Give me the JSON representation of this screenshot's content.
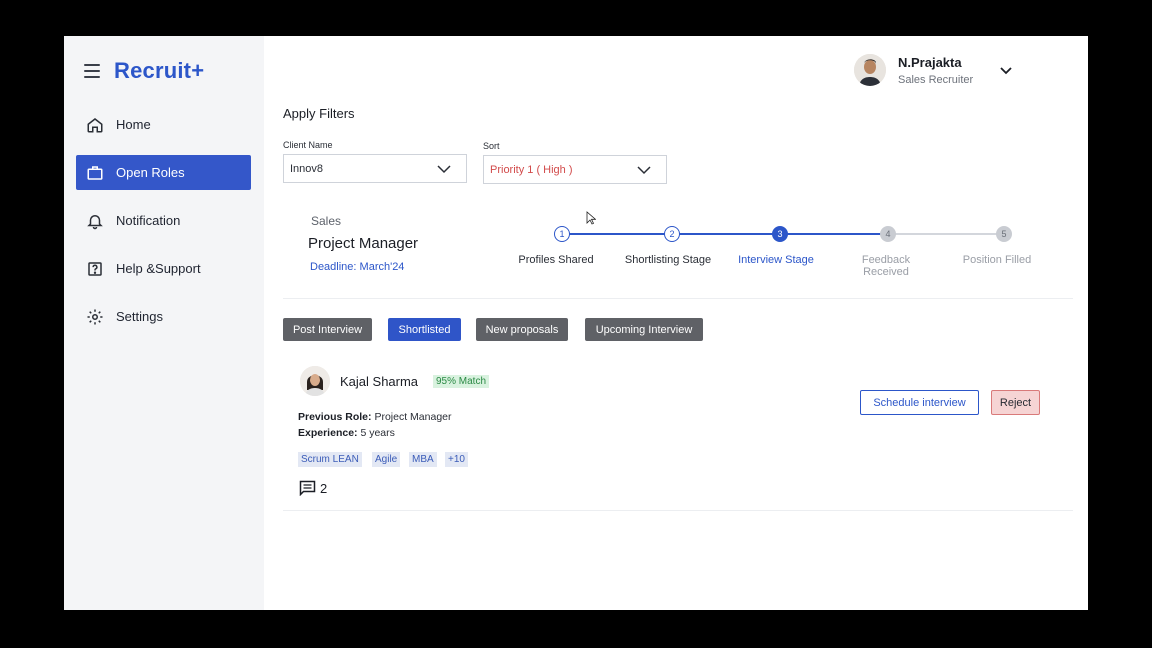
{
  "app": {
    "brand": "Recruit+"
  },
  "sidebar": {
    "items": [
      {
        "label": "Home",
        "icon": "home-icon"
      },
      {
        "label": "Open Roles",
        "icon": "briefcase-icon",
        "active": true
      },
      {
        "label": "Notification",
        "icon": "bell-icon"
      },
      {
        "label": "Help &Support",
        "icon": "help-icon"
      },
      {
        "label": "Settings",
        "icon": "gear-icon"
      }
    ]
  },
  "user": {
    "name": "N.Prajakta",
    "role": "Sales Recruiter"
  },
  "filters": {
    "title": "Apply Filters",
    "client": {
      "label": "Client Name",
      "value": "Innov8"
    },
    "sort": {
      "label": "Sort",
      "value": "Priority 1 ( High )"
    }
  },
  "role": {
    "department": "Sales",
    "title": "Project Manager",
    "deadline": "Deadline: March'24"
  },
  "stepper": {
    "current": 3,
    "steps": [
      {
        "num": "1",
        "label": "Profiles Shared",
        "state": "done"
      },
      {
        "num": "2",
        "label": "Shortlisting Stage",
        "state": "done"
      },
      {
        "num": "3",
        "label": "Interview Stage",
        "state": "current"
      },
      {
        "num": "4",
        "label": "Feedback Received",
        "state": "todo"
      },
      {
        "num": "5",
        "label": "Position Filled",
        "state": "todo"
      }
    ]
  },
  "tabs": [
    {
      "label": "Post Interview"
    },
    {
      "label": "Shortlisted",
      "active": true
    },
    {
      "label": "New proposals"
    },
    {
      "label": "Upcoming Interview"
    }
  ],
  "candidate": {
    "name": "Kajal Sharma",
    "match": "95% Match",
    "previous_role_label": "Previous Role:",
    "previous_role": "Project Manager",
    "experience_label": "Experience:",
    "experience": "5 years",
    "skills": [
      "Scrum LEAN",
      "Agile",
      "MBA",
      "+10"
    ],
    "comment_count": "2",
    "schedule_label": "Schedule interview",
    "reject_label": "Reject"
  },
  "colors": {
    "accent": "#2c56c9",
    "sidebar_bg": "#f4f5f7",
    "tab_inactive": "#5f6166",
    "match_bg": "#d9f2df",
    "reject_bg": "#f6d4d4"
  }
}
